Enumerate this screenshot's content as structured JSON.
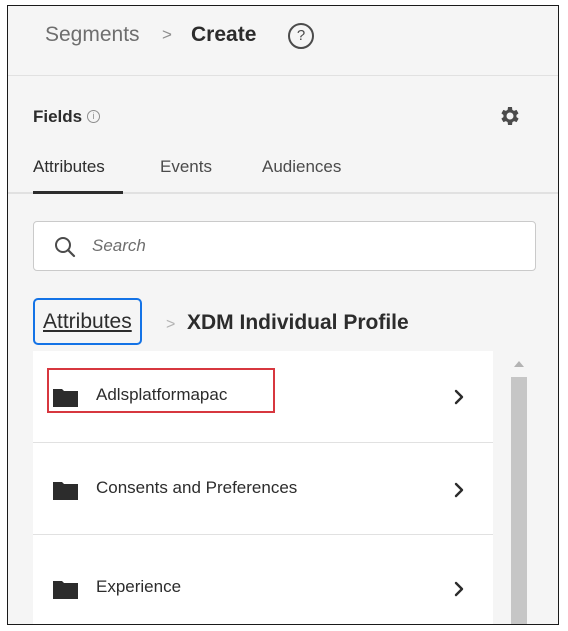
{
  "header": {
    "breadcrumb_parent": "Segments",
    "breadcrumb_separator": ">",
    "breadcrumb_current": "Create",
    "help_glyph": "?"
  },
  "fields": {
    "label": "Fields",
    "info_glyph": "i",
    "settings_icon": "gear-icon"
  },
  "tabs": [
    {
      "label": "Attributes",
      "active": true
    },
    {
      "label": "Events",
      "active": false
    },
    {
      "label": "Audiences",
      "active": false
    }
  ],
  "search": {
    "placeholder": "Search"
  },
  "path": {
    "parent": "Attributes",
    "separator": ">",
    "current": "XDM Individual Profile"
  },
  "list": {
    "items": [
      {
        "label": "Adlsplatformapac",
        "icon": "folder-icon",
        "highlighted": true
      },
      {
        "label": "Consents and Preferences",
        "icon": "folder-icon",
        "highlighted": false
      },
      {
        "label": "Experience",
        "icon": "folder-icon",
        "highlighted": false
      }
    ]
  },
  "colors": {
    "focus_ring": "#1473e6",
    "highlight": "#d7373f",
    "text": "#2c2c2c",
    "background": "#f5f5f5"
  }
}
